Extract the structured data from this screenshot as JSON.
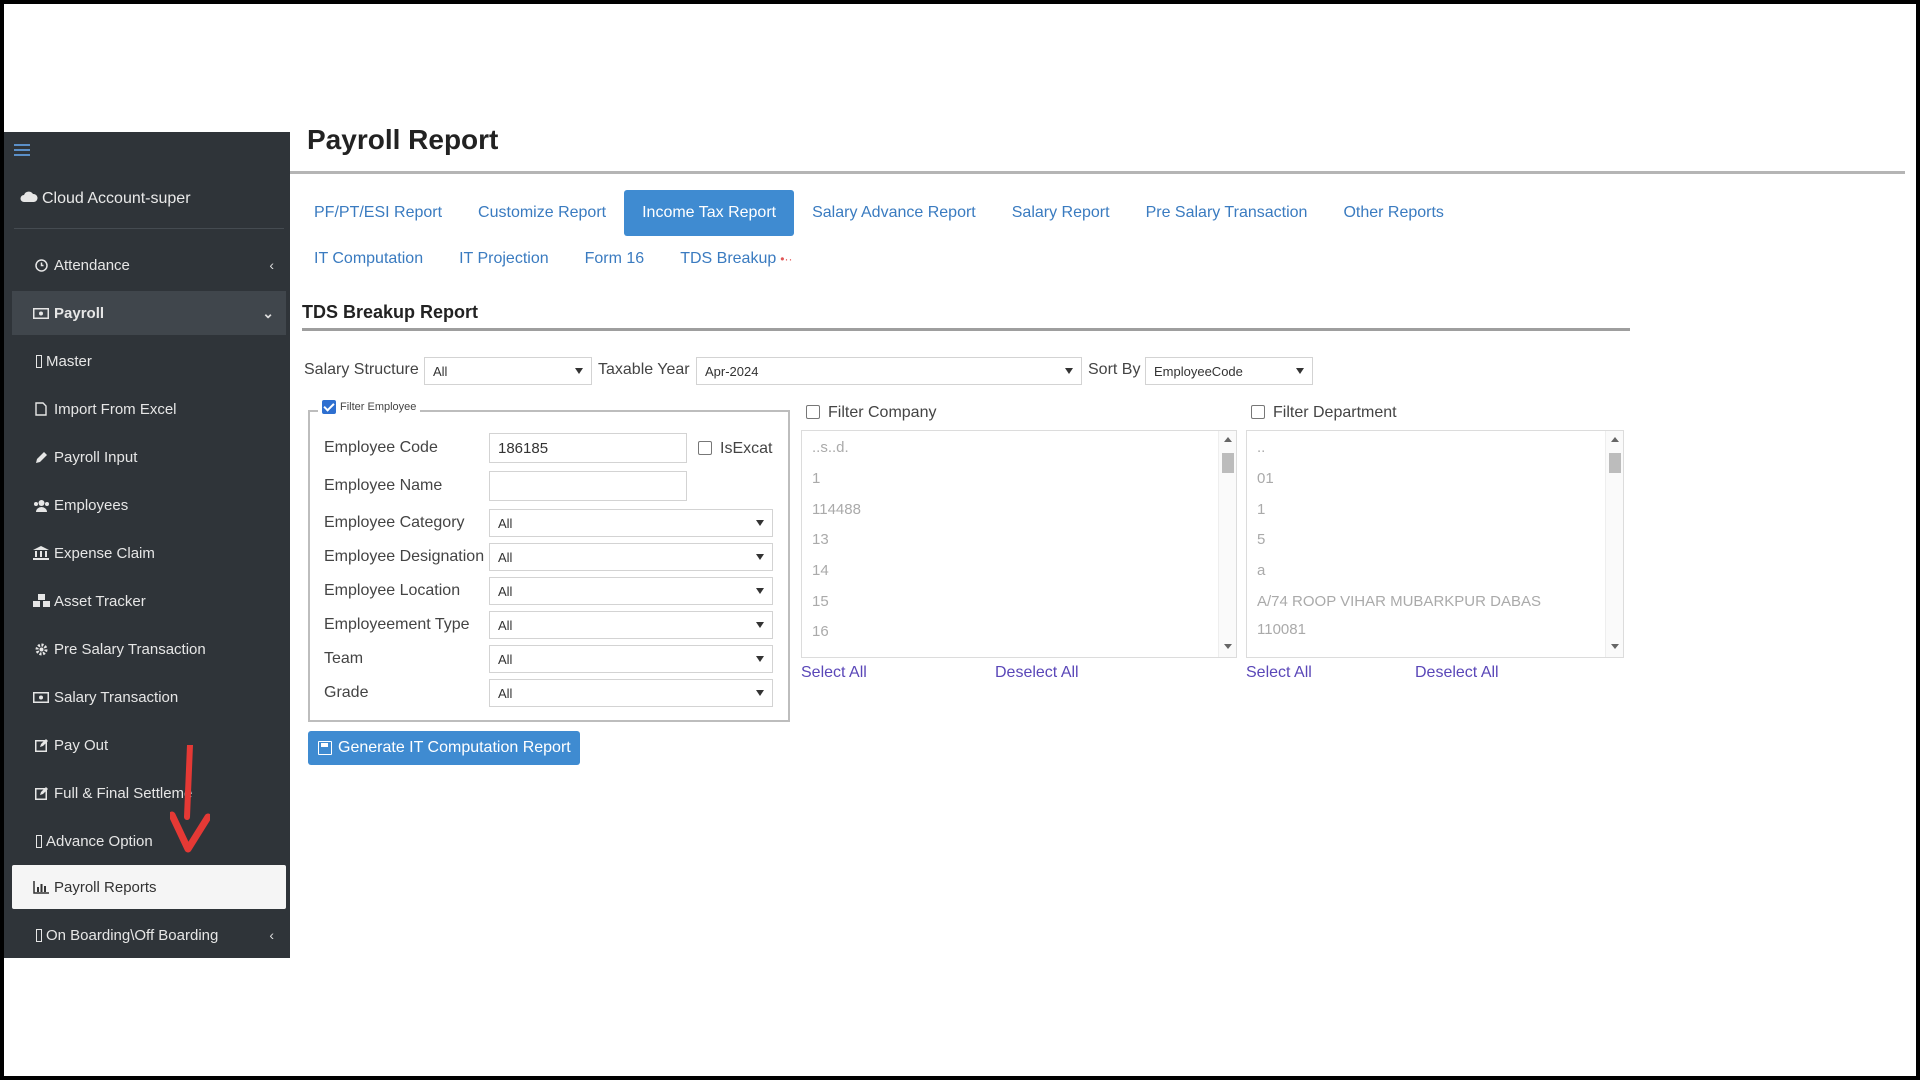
{
  "sidebar": {
    "account": "Cloud Account-super",
    "items": [
      {
        "label": "Attendance",
        "icon": "clock-icon",
        "chevron": "‹"
      },
      {
        "label": "Payroll",
        "icon": "money-icon",
        "chevron": "⌄"
      },
      {
        "label": "Master",
        "icon": "box-icon"
      },
      {
        "label": "Import From Excel",
        "icon": "file-icon"
      },
      {
        "label": "Payroll Input",
        "icon": "pencil-icon"
      },
      {
        "label": "Employees",
        "icon": "users-icon"
      },
      {
        "label": "Expense Claim",
        "icon": "bank-icon"
      },
      {
        "label": "Asset Tracker",
        "icon": "cubes-icon"
      },
      {
        "label": "Pre Salary Transaction",
        "icon": "gear-icon"
      },
      {
        "label": "Salary Transaction",
        "icon": "money-icon"
      },
      {
        "label": "Pay Out",
        "icon": "edit-icon"
      },
      {
        "label": "Full & Final Settleme",
        "icon": "edit-icon"
      },
      {
        "label": "Advance Option",
        "icon": "box-icon"
      },
      {
        "label": "Payroll Reports",
        "icon": "bar-chart-icon"
      },
      {
        "label": "On Boarding\\Off Boarding",
        "icon": "box-icon",
        "chevron": "‹"
      }
    ]
  },
  "page": {
    "title": "Payroll Report"
  },
  "tabs_row1": [
    "PF/PT/ESI Report",
    "Customize Report",
    "Income Tax Report",
    "Salary Advance Report",
    "Salary Report",
    "Pre Salary Transaction",
    "Other Reports"
  ],
  "tabs_row2": [
    "IT Computation",
    "IT Projection",
    "Form 16",
    "TDS Breakup"
  ],
  "section": {
    "title": "TDS Breakup Report"
  },
  "filters": {
    "salary_structure_label": "Salary Structure",
    "salary_structure_value": "All",
    "taxable_year_label": "Taxable Year",
    "taxable_year_value": "Apr-2024",
    "sort_by_label": "Sort By",
    "sort_by_value": "EmployeeCode"
  },
  "filter_employee": {
    "legend": "Filter Employee",
    "employee_code_label": "Employee Code",
    "employee_code_value": "186185",
    "isexact_label": "IsExcat",
    "employee_name_label": "Employee Name",
    "employee_name_value": "",
    "rows": [
      {
        "label": "Employee Category",
        "value": "All"
      },
      {
        "label": "Employee Designation",
        "value": "All"
      },
      {
        "label": "Employee Location",
        "value": "All"
      },
      {
        "label": "Employeement Type",
        "value": "All"
      },
      {
        "label": "Team",
        "value": "All"
      },
      {
        "label": "Grade",
        "value": "All"
      }
    ]
  },
  "filter_company": {
    "label": "Filter Company",
    "items": [
      "..s..d.",
      "1",
      "114488",
      "13",
      "14",
      "15",
      "16"
    ],
    "select_all": "Select All",
    "deselect_all": "Deselect All"
  },
  "filter_department": {
    "label": "Filter Department",
    "items": [
      "..",
      "01",
      "1",
      "5",
      "a",
      "A/74 ROOP VIHAR MUBARKPUR DABAS",
      "110081"
    ],
    "select_all": "Select All",
    "deselect_all": "Deselect All"
  },
  "generate_button": "Generate IT Computation Report",
  "colors": {
    "sidebar_bg": "#2f3439",
    "accent": "#3f8bd1",
    "link": "#3a7bc0",
    "arrow": "#e53935"
  }
}
